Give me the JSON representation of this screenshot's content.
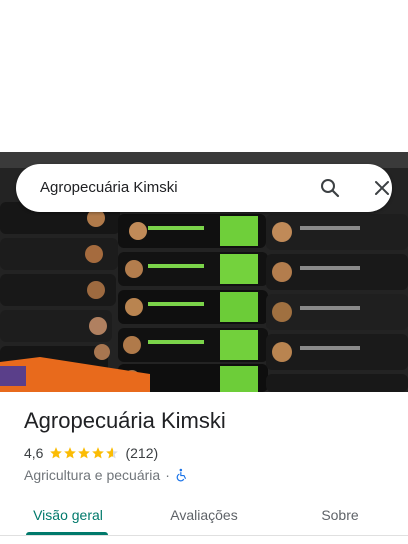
{
  "search": {
    "query": "Agropecuária Kimski"
  },
  "place": {
    "name": "Agropecuária Kimski",
    "rating": "4,6",
    "rating_stars": 4.6,
    "review_count": "(212)",
    "category": "Agricultura e pecuária",
    "separator": "·"
  },
  "tabs": [
    {
      "label": "Visão geral",
      "active": true
    },
    {
      "label": "Avaliações",
      "active": false
    },
    {
      "label": "Sobre",
      "active": false
    }
  ],
  "colors": {
    "accent": "#00796b",
    "star": "#fbbc04",
    "wheelchair": "#1a73e8"
  },
  "icons": {
    "search": "search-icon",
    "close": "close-icon",
    "wheelchair": "wheelchair-icon"
  }
}
